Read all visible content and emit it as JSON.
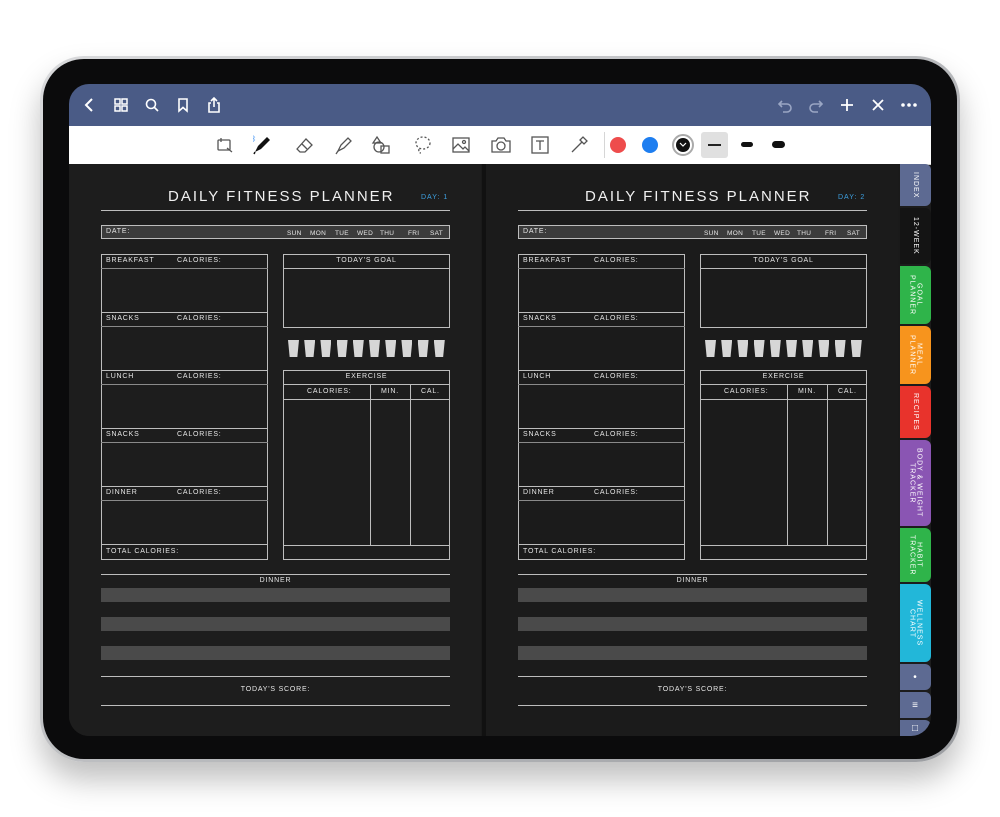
{
  "topbar": {
    "left_icons": [
      "chevron-left-icon",
      "grid-icon",
      "search-icon",
      "bookmark-icon",
      "share-icon"
    ],
    "right_icons": [
      "undo-icon",
      "redo-icon",
      "plus-icon",
      "close-icon",
      "more-icon"
    ]
  },
  "toolbar": {
    "tools": [
      "read-mode-icon",
      "pen-icon",
      "eraser-icon",
      "highlighter-icon",
      "shapes-icon",
      "lasso-icon",
      "image-icon",
      "camera-icon",
      "text-icon",
      "laser-pointer-icon"
    ],
    "colors": [
      "#ee4c4c",
      "#1e7ef0",
      "#111111"
    ],
    "stroke_sizes": [
      "thin",
      "medium",
      "thick"
    ]
  },
  "pages": [
    {
      "title": "DAILY FITNESS PLANNER",
      "day": "DAY: 1",
      "date_label": "DATE:",
      "weekdays": [
        "SUN",
        "MON",
        "TUE",
        "WED",
        "THU",
        "FRI",
        "SAT"
      ],
      "meals": [
        {
          "name": "BREAKFAST",
          "calories": "CALORIES:"
        },
        {
          "name": "SNACKS",
          "calories": "CALORIES:"
        },
        {
          "name": "LUNCH",
          "calories": "CALORIES:"
        },
        {
          "name": "SNACKS",
          "calories": "CALORIES:"
        },
        {
          "name": "DINNER",
          "calories": "CALORIES:"
        }
      ],
      "total_calories": "TOTAL CALORIES:",
      "goal_label": "TODAY'S GOAL",
      "water_cups": 10,
      "exercise_label": "EXERCISE",
      "exercise_cols": [
        "CALORIES:",
        "MIN.",
        "CAL."
      ],
      "dinner_label": "DINNER",
      "score_label": "TODAY'S SCORE:"
    },
    {
      "title": "DAILY FITNESS PLANNER",
      "day": "DAY: 2",
      "date_label": "DATE:",
      "weekdays": [
        "SUN",
        "MON",
        "TUE",
        "WED",
        "THU",
        "FRI",
        "SAT"
      ],
      "meals": [
        {
          "name": "BREAKFAST",
          "calories": "CALORIES:"
        },
        {
          "name": "SNACKS",
          "calories": "CALORIES:"
        },
        {
          "name": "LUNCH",
          "calories": "CALORIES:"
        },
        {
          "name": "SNACKS",
          "calories": "CALORIES:"
        },
        {
          "name": "DINNER",
          "calories": "CALORIES:"
        }
      ],
      "total_calories": "TOTAL CALORIES:",
      "goal_label": "TODAY'S GOAL",
      "water_cups": 10,
      "exercise_label": "EXERCISE",
      "exercise_cols": [
        "CALORIES:",
        "MIN.",
        "CAL."
      ],
      "dinner_label": "DINNER",
      "score_label": "TODAY'S SCORE:"
    }
  ],
  "tabs": [
    {
      "label": "INDEX",
      "color": "#5d6a92"
    },
    {
      "label": "12-WEEK",
      "color": "#141414"
    },
    {
      "label": "GOAL\nPLANNER",
      "color": "#2fb44a"
    },
    {
      "label": "MEAL\nPLANNER",
      "color": "#f7941d"
    },
    {
      "label": "RECIPES",
      "color": "#e8332c"
    },
    {
      "label": "BODY & WEIGHT\nTRACKER",
      "color": "#8a55b3"
    },
    {
      "label": "HABIT\nTRACKER",
      "color": "#2fb44a"
    },
    {
      "label": "WELLNESS\nCHART",
      "color": "#22b7d9"
    },
    {
      "label": "•",
      "color": "#5d6a92"
    },
    {
      "label": "≡",
      "color": "#5d6a92"
    },
    {
      "label": "□",
      "color": "#5d6a92"
    }
  ]
}
